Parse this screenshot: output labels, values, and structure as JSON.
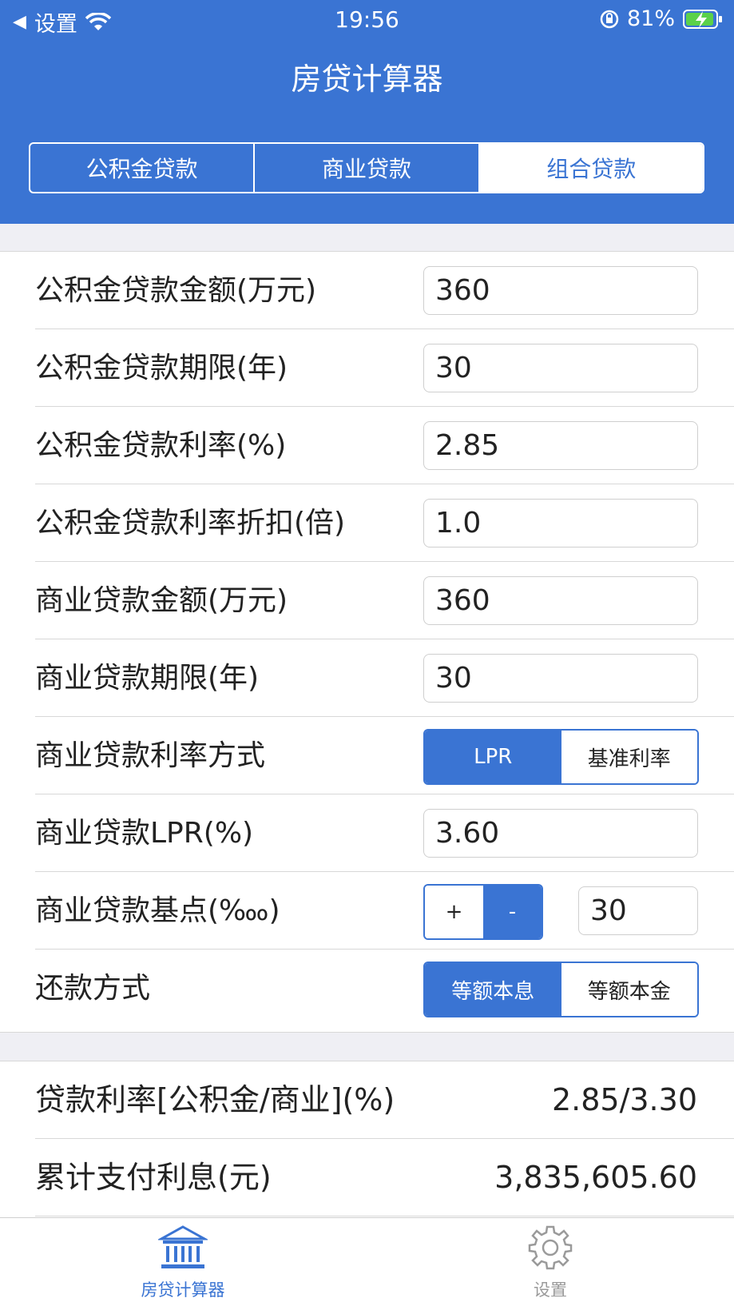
{
  "status": {
    "back_label": "设置",
    "time": "19:56",
    "battery": "81%"
  },
  "header": {
    "title": "房贷计算器"
  },
  "tabs": [
    "公积金贷款",
    "商业贷款",
    "组合贷款"
  ],
  "form": {
    "fund_amount_label": "公积金贷款金额(万元)",
    "fund_amount": "360",
    "fund_term_label": "公积金贷款期限(年)",
    "fund_term": "30",
    "fund_rate_label": "公积金贷款利率(%)",
    "fund_rate": "2.85",
    "fund_discount_label": "公积金贷款利率折扣(倍)",
    "fund_discount": "1.0",
    "biz_amount_label": "商业贷款金额(万元)",
    "biz_amount": "360",
    "biz_term_label": "商业贷款期限(年)",
    "biz_term": "30",
    "biz_rate_mode_label": "商业贷款利率方式",
    "rate_mode_lpr": "LPR",
    "rate_mode_base": "基准利率",
    "biz_lpr_label": "商业贷款LPR(%)",
    "biz_lpr": "3.60",
    "biz_bp_label": "商业贷款基点(‱)",
    "plus": "+",
    "minus": "-",
    "biz_bp": "30",
    "repay_label": "还款方式",
    "repay_equal_payment": "等额本息",
    "repay_equal_principal": "等额本金"
  },
  "results": {
    "rate_label": "贷款利率[公积金/商业](%)",
    "rate_value": "2.85/3.30",
    "interest_label": "累计支付利息(元)",
    "interest_value": "3,835,605.60"
  },
  "tabbar": {
    "calc_label": "房贷计算器",
    "settings_label": "设置"
  },
  "colors": {
    "primary": "#3a74d3",
    "inactive": "#9a9a9a"
  }
}
